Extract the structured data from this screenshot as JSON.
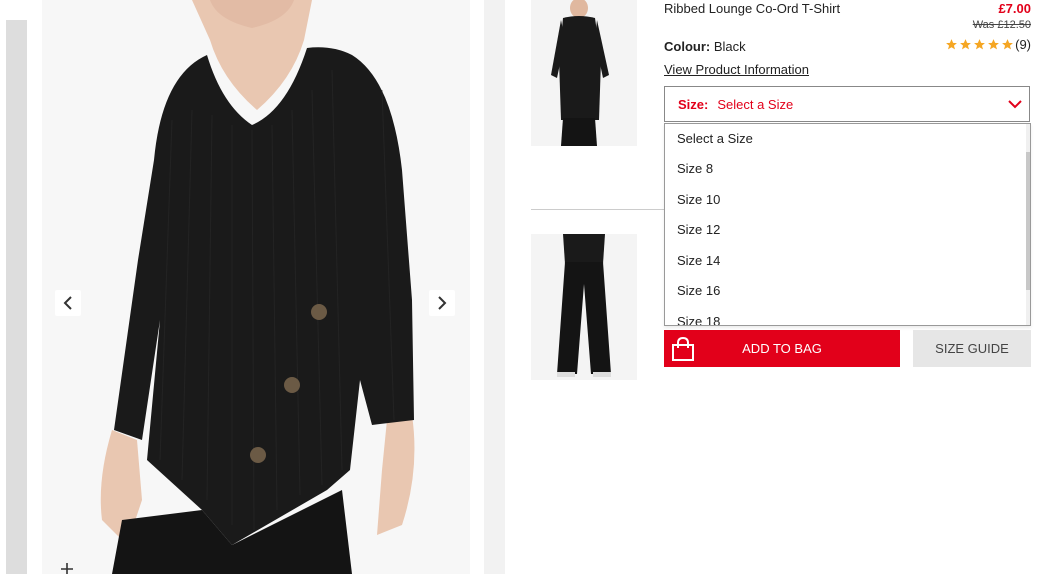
{
  "product": {
    "title": "Ribbed Lounge Co-Ord T-Shirt",
    "price": "£7.00",
    "was_price": "Was £12.50",
    "colour_label": "Colour:",
    "colour_value": "Black",
    "rating_count": "(9)",
    "rating_stars": 5,
    "view_info": "View Product Information"
  },
  "size": {
    "label": "Size:",
    "selected": "Select a Size",
    "options": [
      "Select a Size",
      "Size 8",
      "Size 10",
      "Size 12",
      "Size 14",
      "Size 16",
      "Size 18"
    ]
  },
  "actions": {
    "add_to_bag": "ADD TO BAG",
    "size_guide": "SIZE GUIDE"
  },
  "icons": {
    "prev": "chevron-left-icon",
    "next": "chevron-right-icon",
    "zoom": "plus-icon",
    "dropdown": "chevron-down-icon",
    "bag": "shopping-bag-icon",
    "star": "star-icon"
  },
  "colors": {
    "accent": "#e2001a",
    "star": "#f5a623",
    "garment": "#1a1a1a"
  }
}
